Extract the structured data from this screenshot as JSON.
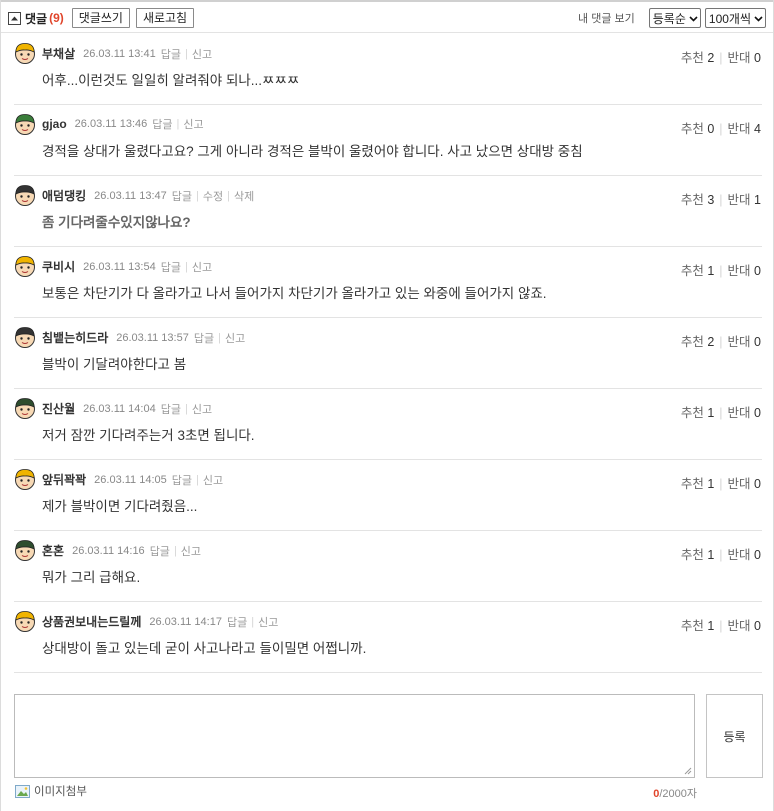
{
  "header": {
    "title": "댓글",
    "count": "(9)",
    "write_label": "댓글쓰기",
    "refresh_label": "새로고침",
    "my_comments_label": "내 댓글 보기",
    "sort_value": "등록순",
    "per_page_value": "100개씩"
  },
  "comments": [
    {
      "author": "부채살",
      "date": "26.03.11 13:41",
      "actions": [
        "답글",
        "신고"
      ],
      "text": "어후...이런것도 일일히 알려줘야 되나...ㅉㅉㅉ",
      "bold": false,
      "up_label": "추천",
      "up": "2",
      "down_label": "반대",
      "down": "0",
      "avatar_color": "#f0b400"
    },
    {
      "author": "gjao",
      "date": "26.03.11 13:46",
      "actions": [
        "답글",
        "신고"
      ],
      "text": "경적을 상대가 울렸다고요? 그게 아니라 경적은 블박이 울렸어야 합니다. 사고 났으면 상대방 중침",
      "bold": false,
      "up_label": "추천",
      "up": "0",
      "down_label": "반대",
      "down": "4",
      "avatar_color": "#3a7d3a"
    },
    {
      "author": "애덤댕킹",
      "date": "26.03.11 13:47",
      "actions": [
        "답글",
        "수정",
        "삭제"
      ],
      "text": "좀 기다려줄수있지않나요?",
      "bold": true,
      "up_label": "추천",
      "up": "3",
      "down_label": "반대",
      "down": "1",
      "avatar_color": "#333333"
    },
    {
      "author": "쿠비시",
      "date": "26.03.11 13:54",
      "actions": [
        "답글",
        "신고"
      ],
      "text": "보통은 차단기가 다 올라가고 나서 들어가지 차단기가 올라가고 있는 와중에 들어가지 않죠.",
      "bold": false,
      "up_label": "추천",
      "up": "1",
      "down_label": "반대",
      "down": "0",
      "avatar_color": "#f0b400"
    },
    {
      "author": "침뱉는히드라",
      "date": "26.03.11 13:57",
      "actions": [
        "답글",
        "신고"
      ],
      "text": "블박이 기달려야한다고 봄",
      "bold": false,
      "up_label": "추천",
      "up": "2",
      "down_label": "반대",
      "down": "0",
      "avatar_color": "#333333"
    },
    {
      "author": "진산월",
      "date": "26.03.11 14:04",
      "actions": [
        "답글",
        "신고"
      ],
      "text": "저거 잠깐 기다려주는거 3초면 됩니다.",
      "bold": false,
      "up_label": "추천",
      "up": "1",
      "down_label": "반대",
      "down": "0",
      "avatar_color": "#2e4d2e"
    },
    {
      "author": "앞뒤꽉꽉",
      "date": "26.03.11 14:05",
      "actions": [
        "답글",
        "신고"
      ],
      "text": "제가 블박이면 기다려줬음...",
      "bold": false,
      "up_label": "추천",
      "up": "1",
      "down_label": "반대",
      "down": "0",
      "avatar_color": "#f0b400"
    },
    {
      "author": "혼혼",
      "date": "26.03.11 14:16",
      "actions": [
        "답글",
        "신고"
      ],
      "text": "뭐가 그리 급해요.",
      "bold": false,
      "up_label": "추천",
      "up": "1",
      "down_label": "반대",
      "down": "0",
      "avatar_color": "#2e4d2e"
    },
    {
      "author": "상품권보내는드릴께",
      "date": "26.03.11 14:17",
      "actions": [
        "답글",
        "신고"
      ],
      "text": "상대방이 돌고 있는데 굳이 사고나라고 들이밀면 어쩝니까.",
      "bold": false,
      "up_label": "추천",
      "up": "1",
      "down_label": "반대",
      "down": "0",
      "avatar_color": "#f0b400"
    }
  ],
  "editor": {
    "submit_label": "등록",
    "attach_label": "이미지첨부",
    "count_current": "0",
    "count_max": "/2000자"
  }
}
